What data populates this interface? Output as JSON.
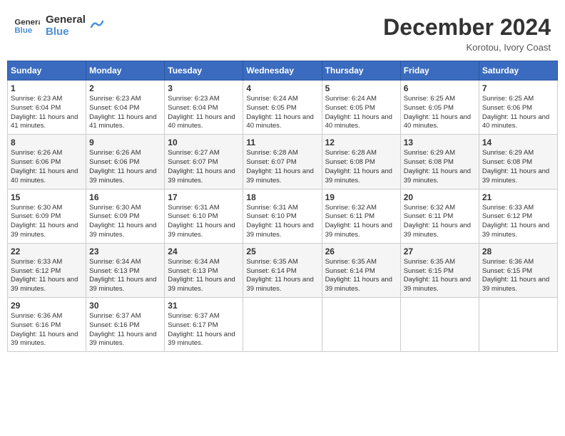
{
  "header": {
    "logo_line1": "General",
    "logo_line2": "Blue",
    "month_title": "December 2024",
    "subtitle": "Korotou, Ivory Coast"
  },
  "weekdays": [
    "Sunday",
    "Monday",
    "Tuesday",
    "Wednesday",
    "Thursday",
    "Friday",
    "Saturday"
  ],
  "weeks": [
    [
      {
        "day": "1",
        "info": "Sunrise: 6:23 AM\nSunset: 6:04 PM\nDaylight: 11 hours and 41 minutes."
      },
      {
        "day": "2",
        "info": "Sunrise: 6:23 AM\nSunset: 6:04 PM\nDaylight: 11 hours and 41 minutes."
      },
      {
        "day": "3",
        "info": "Sunrise: 6:23 AM\nSunset: 6:04 PM\nDaylight: 11 hours and 40 minutes."
      },
      {
        "day": "4",
        "info": "Sunrise: 6:24 AM\nSunset: 6:05 PM\nDaylight: 11 hours and 40 minutes."
      },
      {
        "day": "5",
        "info": "Sunrise: 6:24 AM\nSunset: 6:05 PM\nDaylight: 11 hours and 40 minutes."
      },
      {
        "day": "6",
        "info": "Sunrise: 6:25 AM\nSunset: 6:05 PM\nDaylight: 11 hours and 40 minutes."
      },
      {
        "day": "7",
        "info": "Sunrise: 6:25 AM\nSunset: 6:06 PM\nDaylight: 11 hours and 40 minutes."
      }
    ],
    [
      {
        "day": "8",
        "info": "Sunrise: 6:26 AM\nSunset: 6:06 PM\nDaylight: 11 hours and 40 minutes."
      },
      {
        "day": "9",
        "info": "Sunrise: 6:26 AM\nSunset: 6:06 PM\nDaylight: 11 hours and 39 minutes."
      },
      {
        "day": "10",
        "info": "Sunrise: 6:27 AM\nSunset: 6:07 PM\nDaylight: 11 hours and 39 minutes."
      },
      {
        "day": "11",
        "info": "Sunrise: 6:28 AM\nSunset: 6:07 PM\nDaylight: 11 hours and 39 minutes."
      },
      {
        "day": "12",
        "info": "Sunrise: 6:28 AM\nSunset: 6:08 PM\nDaylight: 11 hours and 39 minutes."
      },
      {
        "day": "13",
        "info": "Sunrise: 6:29 AM\nSunset: 6:08 PM\nDaylight: 11 hours and 39 minutes."
      },
      {
        "day": "14",
        "info": "Sunrise: 6:29 AM\nSunset: 6:08 PM\nDaylight: 11 hours and 39 minutes."
      }
    ],
    [
      {
        "day": "15",
        "info": "Sunrise: 6:30 AM\nSunset: 6:09 PM\nDaylight: 11 hours and 39 minutes."
      },
      {
        "day": "16",
        "info": "Sunrise: 6:30 AM\nSunset: 6:09 PM\nDaylight: 11 hours and 39 minutes."
      },
      {
        "day": "17",
        "info": "Sunrise: 6:31 AM\nSunset: 6:10 PM\nDaylight: 11 hours and 39 minutes."
      },
      {
        "day": "18",
        "info": "Sunrise: 6:31 AM\nSunset: 6:10 PM\nDaylight: 11 hours and 39 minutes."
      },
      {
        "day": "19",
        "info": "Sunrise: 6:32 AM\nSunset: 6:11 PM\nDaylight: 11 hours and 39 minutes."
      },
      {
        "day": "20",
        "info": "Sunrise: 6:32 AM\nSunset: 6:11 PM\nDaylight: 11 hours and 39 minutes."
      },
      {
        "day": "21",
        "info": "Sunrise: 6:33 AM\nSunset: 6:12 PM\nDaylight: 11 hours and 39 minutes."
      }
    ],
    [
      {
        "day": "22",
        "info": "Sunrise: 6:33 AM\nSunset: 6:12 PM\nDaylight: 11 hours and 39 minutes."
      },
      {
        "day": "23",
        "info": "Sunrise: 6:34 AM\nSunset: 6:13 PM\nDaylight: 11 hours and 39 minutes."
      },
      {
        "day": "24",
        "info": "Sunrise: 6:34 AM\nSunset: 6:13 PM\nDaylight: 11 hours and 39 minutes."
      },
      {
        "day": "25",
        "info": "Sunrise: 6:35 AM\nSunset: 6:14 PM\nDaylight: 11 hours and 39 minutes."
      },
      {
        "day": "26",
        "info": "Sunrise: 6:35 AM\nSunset: 6:14 PM\nDaylight: 11 hours and 39 minutes."
      },
      {
        "day": "27",
        "info": "Sunrise: 6:35 AM\nSunset: 6:15 PM\nDaylight: 11 hours and 39 minutes."
      },
      {
        "day": "28",
        "info": "Sunrise: 6:36 AM\nSunset: 6:15 PM\nDaylight: 11 hours and 39 minutes."
      }
    ],
    [
      {
        "day": "29",
        "info": "Sunrise: 6:36 AM\nSunset: 6:16 PM\nDaylight: 11 hours and 39 minutes."
      },
      {
        "day": "30",
        "info": "Sunrise: 6:37 AM\nSunset: 6:16 PM\nDaylight: 11 hours and 39 minutes."
      },
      {
        "day": "31",
        "info": "Sunrise: 6:37 AM\nSunset: 6:17 PM\nDaylight: 11 hours and 39 minutes."
      },
      null,
      null,
      null,
      null
    ]
  ]
}
